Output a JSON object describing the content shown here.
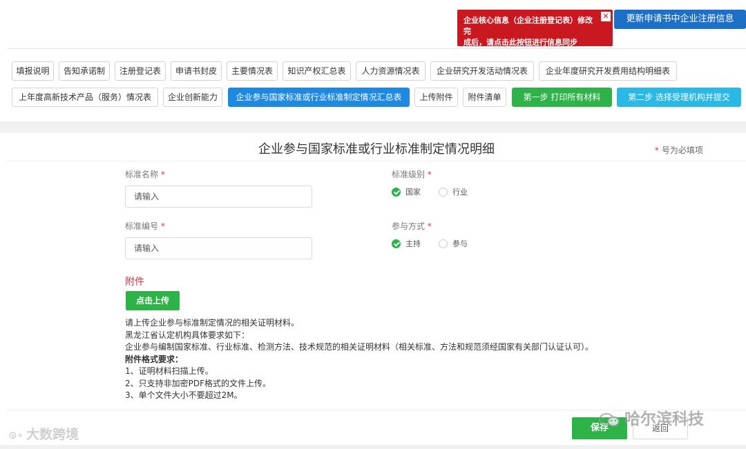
{
  "header": {
    "alert_line1": "企业核心信息（企业注册登记表）修改完",
    "alert_line2": "成后，请点击此按钮进行信息同步",
    "alert_close": "✕",
    "sync_button": "更新申请书中企业注册信息",
    "colors": {
      "alert": "#c9181f",
      "primary": "#1e6fc6"
    }
  },
  "tabs": {
    "row1": [
      "填报说明",
      "告知承诺制",
      "注册登记表",
      "申请书封皮",
      "主要情况表",
      "知识产权汇总表",
      "人力资源情况表",
      "企业研究开发活动情况表",
      "企业年度研究开发费用结构明细表"
    ],
    "row2": [
      "上年度高新技术产品（服务）情况表",
      "企业创新能力",
      "企业参与国家标准或行业标准制定情况汇总表",
      "上传附件",
      "附件清单"
    ],
    "step1": "第一步 打印所有材料",
    "step2": "第二步 选择受理机构并提交",
    "active_tab": "企业参与国家标准或行业标准制定情况汇总表",
    "colors": {
      "active": "#1e89e0",
      "step1": "#2eb348",
      "step2": "#2ab8e6"
    }
  },
  "form": {
    "title": "企业参与国家标准或行业标准制定情况明细",
    "required_note_star": "*",
    "required_note": " 号为必填项",
    "standard_name": {
      "label": "标准名称",
      "star": " *",
      "placeholder": "请输入"
    },
    "standard_no": {
      "label": "标准编号",
      "star": " *",
      "placeholder": "请输入"
    },
    "standard_level": {
      "label": "标准级别",
      "star": " *",
      "options": [
        "国家",
        "行业"
      ],
      "selected": "国家"
    },
    "participation": {
      "label": "参与方式",
      "star": " *",
      "options": [
        "主持",
        "参与"
      ],
      "selected": "主持"
    },
    "attachment_title": "附件",
    "upload_button": "点击上传",
    "notes": [
      "请上传企业参与标准制定情况的相关证明材料。",
      "黑龙江省认定机构具体要求如下：",
      "企业参与编制国家标准、行业标准、检测方法、技术规范的相关证明材料（相关标准、方法和规范须经国家有关部门认证认可）。",
      "附件格式要求：",
      "1、证明材料扫描上传。",
      "2、只支持非加密PDF格式的文件上传。",
      "3、单个文件大小不要超过2M。"
    ],
    "save_button": "保存",
    "back_button": "返回"
  },
  "watermarks": {
    "left": "大数跨境",
    "right": "哈尔滨科技"
  }
}
